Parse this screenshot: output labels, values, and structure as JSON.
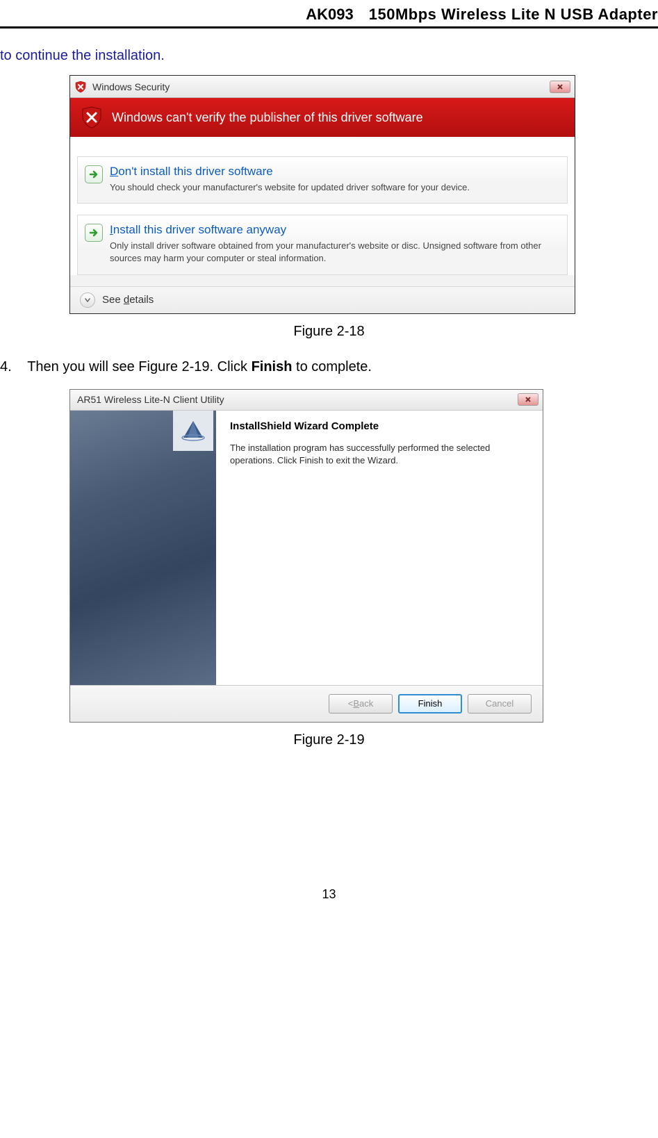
{
  "header": {
    "code": "AK093",
    "product": "150Mbps Wireless Lite N USB Adapter"
  },
  "intro": "to continue the installation.",
  "dialog1": {
    "title": "Windows Security",
    "banner": "Windows can't verify the publisher of this driver software",
    "option1": {
      "title_pref": "D",
      "title_rest": "on't install this driver software",
      "desc": "You should check your manufacturer's website for updated driver software for your device."
    },
    "option2": {
      "title_pref": "I",
      "title_rest": "nstall this driver software anyway",
      "desc": "Only install driver software obtained from your manufacturer's website or disc. Unsigned software from other sources may harm your computer or steal information."
    },
    "see_details_pref": "See ",
    "see_details_letter": "d",
    "see_details_rest": "etails"
  },
  "caption1": "Figure 2-18",
  "step4": {
    "num": "4.",
    "before": "Then you will see Figure 2-19. Click ",
    "bold": "Finish",
    "after": " to complete."
  },
  "dialog2": {
    "title": "AR51 Wireless Lite-N Client Utility",
    "heading": "InstallShield Wizard Complete",
    "desc": "The installation program has successfully performed the selected operations.  Click Finish to exit the Wizard.",
    "back_pref": "< ",
    "back_letter": "B",
    "back_rest": "ack",
    "finish": "Finish",
    "cancel": "Cancel"
  },
  "caption2": "Figure 2-19",
  "page_number": "13"
}
